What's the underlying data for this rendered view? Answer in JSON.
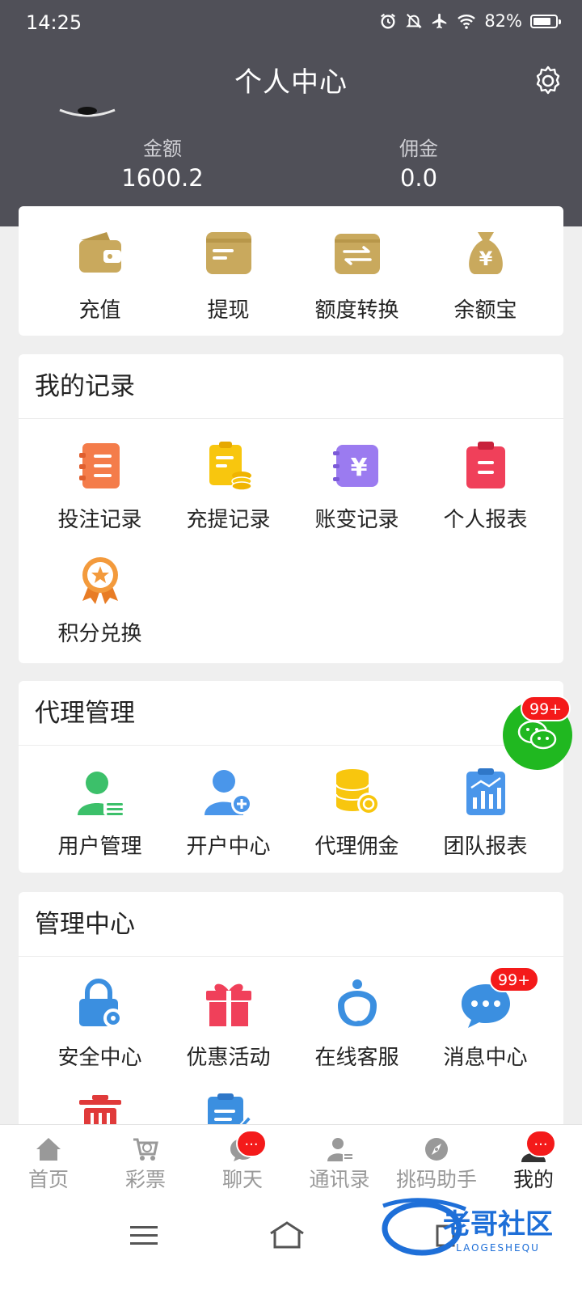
{
  "status_bar": {
    "time": "14:25",
    "battery": "82%",
    "battery_level": 0.82
  },
  "header": {
    "title": "个人中心",
    "balance_label": "金额",
    "balance_value": "1600.2",
    "commission_label": "佣金",
    "commission_value": "0.0"
  },
  "quick_actions": [
    {
      "label": "充值",
      "icon": "wallet-icon"
    },
    {
      "label": "提现",
      "icon": "withdraw-card-icon"
    },
    {
      "label": "额度转换",
      "icon": "transfer-icon"
    },
    {
      "label": "余额宝",
      "icon": "money-bag-icon"
    }
  ],
  "records": {
    "title": "我的记录",
    "items": [
      {
        "label": "投注记录",
        "icon": "bet-record-icon"
      },
      {
        "label": "充提记录",
        "icon": "deposit-record-icon"
      },
      {
        "label": "账变记录",
        "icon": "account-change-icon"
      },
      {
        "label": "个人报表",
        "icon": "personal-report-icon"
      },
      {
        "label": "积分兑换",
        "icon": "points-medal-icon"
      }
    ]
  },
  "agent": {
    "title": "代理管理",
    "items": [
      {
        "label": "用户管理",
        "icon": "user-manage-icon"
      },
      {
        "label": "开户中心",
        "icon": "add-user-icon"
      },
      {
        "label": "代理佣金",
        "icon": "coins-icon"
      },
      {
        "label": "团队报表",
        "icon": "team-report-icon"
      }
    ]
  },
  "management": {
    "title": "管理中心",
    "items": [
      {
        "label": "安全中心",
        "icon": "lock-gear-icon"
      },
      {
        "label": "优惠活动",
        "icon": "gift-icon"
      },
      {
        "label": "在线客服",
        "icon": "customer-service-icon"
      },
      {
        "label": "消息中心",
        "icon": "chat-bubble-icon",
        "badge": "99+"
      },
      {
        "label": "",
        "icon": "trash-icon"
      },
      {
        "label": "",
        "icon": "edit-note-icon"
      }
    ]
  },
  "float_chat": {
    "badge": "99+",
    "icon": "wechat-icon"
  },
  "bottom_nav": [
    {
      "label": "首页",
      "icon": "home-icon"
    },
    {
      "label": "彩票",
      "icon": "lottery-cart-icon"
    },
    {
      "label": "聊天",
      "icon": "chat-icon",
      "badge": "..."
    },
    {
      "label": "通讯录",
      "icon": "contacts-icon"
    },
    {
      "label": "挑码助手",
      "icon": "compass-icon"
    },
    {
      "label": "我的",
      "icon": "profile-icon",
      "badge": "...",
      "active": true
    }
  ],
  "watermark": {
    "text": "老哥社区",
    "subtext": "LAOGESHEQU"
  },
  "colors": {
    "header_bg": "#505058",
    "gold": "#c9a95d",
    "badge_red": "#f41a1a",
    "chat_green": "#20b820"
  }
}
